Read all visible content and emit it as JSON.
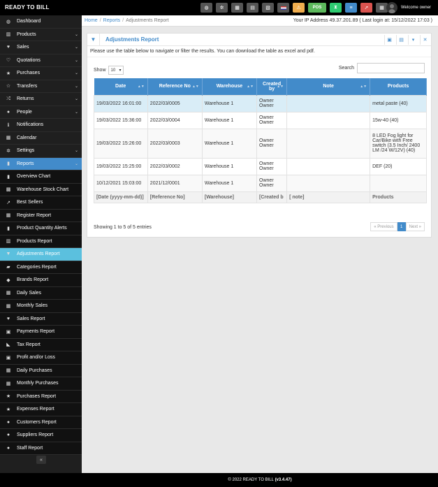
{
  "app": {
    "brand": "READY TO BILL",
    "welcome": "Welcome owner"
  },
  "topbar": {
    "pos_label": "POS",
    "colors": {
      "orange": "#f0ad4e",
      "green": "#5cb85c",
      "blue": "#428bca",
      "red": "#d9534f"
    }
  },
  "sidebar": {
    "items": [
      {
        "label": "Dashboard",
        "icon": "dashboard-icon",
        "glyph": "◍",
        "chevron": false
      },
      {
        "label": "Products",
        "icon": "barcode-icon",
        "glyph": "▥",
        "chevron": true
      },
      {
        "label": "Sales",
        "icon": "heart-icon",
        "glyph": "♥",
        "chevron": true
      },
      {
        "label": "Quotations",
        "icon": "heart-outline-icon",
        "glyph": "♡",
        "chevron": true
      },
      {
        "label": "Purchases",
        "icon": "star-icon",
        "glyph": "★",
        "chevron": true
      },
      {
        "label": "Transfers",
        "icon": "star-outline-icon",
        "glyph": "☆",
        "chevron": true
      },
      {
        "label": "Returns",
        "icon": "random-icon",
        "glyph": "⤮",
        "chevron": true
      },
      {
        "label": "People",
        "icon": "users-icon",
        "glyph": "●",
        "chevron": true
      },
      {
        "label": "Notifications",
        "icon": "info-icon",
        "glyph": "ℹ",
        "chevron": false
      },
      {
        "label": "Calendar",
        "icon": "calendar-icon",
        "glyph": "▦",
        "chevron": false
      },
      {
        "label": "Settings",
        "icon": "cog-icon",
        "glyph": "✲",
        "chevron": true
      },
      {
        "label": "Reports",
        "icon": "bar-chart-icon",
        "glyph": "▮",
        "chevron": true,
        "active": true
      }
    ],
    "report_items": [
      {
        "label": "Overview Chart",
        "icon": "bar-chart-icon",
        "glyph": "▮"
      },
      {
        "label": "Warehouse Stock Chart",
        "icon": "building-icon",
        "glyph": "▩"
      },
      {
        "label": "Best Sellers",
        "icon": "line-chart-icon",
        "glyph": "↗"
      },
      {
        "label": "Register Report",
        "icon": "th-icon",
        "glyph": "▦"
      },
      {
        "label": "Product Quantity Alerts",
        "icon": "bar-chart-icon",
        "glyph": "▮"
      },
      {
        "label": "Products Report",
        "icon": "barcode-icon",
        "glyph": "▥"
      },
      {
        "label": "Adjustments Report",
        "icon": "filter-icon",
        "glyph": "▼",
        "active": true
      },
      {
        "label": "Categories Report",
        "icon": "folder-icon",
        "glyph": "▰"
      },
      {
        "label": "Brands Report",
        "icon": "cubes-icon",
        "glyph": "◆"
      },
      {
        "label": "Daily Sales",
        "icon": "calendar-icon",
        "glyph": "▦"
      },
      {
        "label": "Monthly Sales",
        "icon": "calendar-icon",
        "glyph": "▦"
      },
      {
        "label": "Sales Report",
        "icon": "heart-icon",
        "glyph": "♥"
      },
      {
        "label": "Payments Report",
        "icon": "money-icon",
        "glyph": "▣"
      },
      {
        "label": "Tax Report",
        "icon": "area-chart-icon",
        "glyph": "◣"
      },
      {
        "label": "Profit and/or Loss",
        "icon": "money-icon",
        "glyph": "▣"
      },
      {
        "label": "Daily Purchases",
        "icon": "calendar-icon",
        "glyph": "▦"
      },
      {
        "label": "Monthly Purchases",
        "icon": "calendar-icon",
        "glyph": "▦"
      },
      {
        "label": "Purchases Report",
        "icon": "star-icon",
        "glyph": "★"
      },
      {
        "label": "Expenses Report",
        "icon": "star-icon",
        "glyph": "★"
      },
      {
        "label": "Customers Report",
        "icon": "users-icon",
        "glyph": "●"
      },
      {
        "label": "Suppliers Report",
        "icon": "users-icon",
        "glyph": "●"
      },
      {
        "label": "Staff Report",
        "icon": "users-icon",
        "glyph": "●"
      }
    ]
  },
  "breadcrumb": {
    "home": "Home",
    "reports": "Reports",
    "current": "Adjustments Report"
  },
  "ip_info": "Your IP Address 49.37.201.89 ( Last login at: 15/12/2022 17:03 )",
  "panel": {
    "title": "Adjustments Report",
    "intro": "Please use the table below to navigate or filter the results. You can download the table as excel and pdf.",
    "show_label": "Show",
    "show_value": "10",
    "search_label": "Search"
  },
  "table": {
    "headers": [
      "Date",
      "Reference No",
      "Warehouse",
      "Created by",
      "Note",
      "Products"
    ],
    "rows": [
      {
        "date": "19/03/2022 16:01:00",
        "ref": "2022/03/0005",
        "warehouse": "Warehouse 1",
        "created": "Owner Owner",
        "note": "",
        "products": "metal paste (40)"
      },
      {
        "date": "19/03/2022 15:36:00",
        "ref": "2022/03/0004",
        "warehouse": "Warehouse 1",
        "created": "Owner Owner",
        "note": "",
        "products": "15w-40 (40)"
      },
      {
        "date": "19/03/2022 15:26:00",
        "ref": "2022/03/0003",
        "warehouse": "Warehouse 1",
        "created": "Owner Owner",
        "note": "",
        "products": "8 LED Fog light for Car/Bike with Free switch (3.5 Inch/ 2400 LM /24 W/12V) (40)"
      },
      {
        "date": "19/03/2022 15:25:00",
        "ref": "2022/03/0002",
        "warehouse": "Warehouse 1",
        "created": "Owner Owner",
        "note": "",
        "products": "DEF (20)"
      },
      {
        "date": "10/12/2021 15:03:00",
        "ref": "2021/12/0001",
        "warehouse": "Warehouse 1",
        "created": "Owner Owner",
        "note": "",
        "products": ""
      }
    ],
    "footer": [
      "[Date (yyyy-mm-dd)]",
      "[Reference No]",
      "[Warehouse]",
      "[Created b",
      "[ note]",
      "Products"
    ]
  },
  "summary": "Showing 1 to 5 of 5 entries",
  "pager": {
    "prev": "« Previous",
    "page": "1",
    "next": "Next »"
  },
  "footer": {
    "text": "© 2022 READY TO BILL",
    "version": "(v3.4.47)"
  }
}
